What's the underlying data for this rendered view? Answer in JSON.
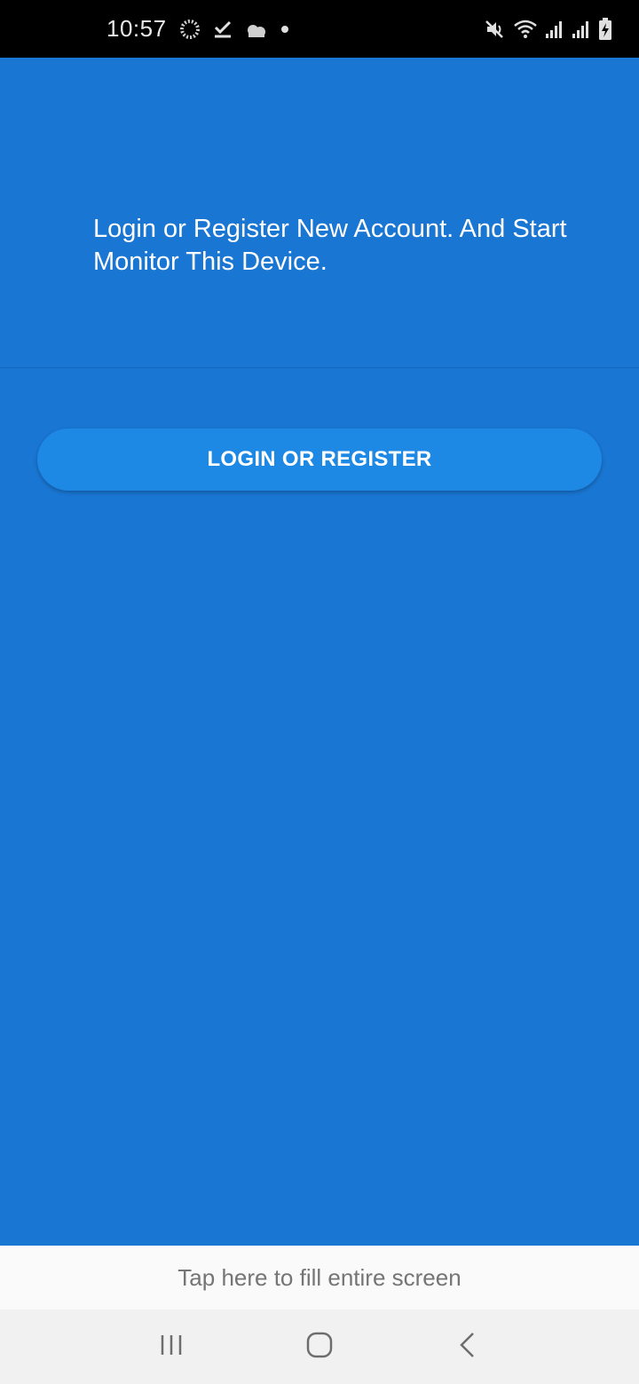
{
  "status_bar": {
    "time": "10:57",
    "left_icons": [
      "loading-circle-icon",
      "download-check-icon",
      "cloud-icon",
      "dot-icon"
    ],
    "right_icons": [
      "mute-icon",
      "wifi-icon",
      "signal-icon",
      "signal-icon",
      "battery-charging-icon"
    ]
  },
  "header": {
    "message": "Login or Register New Account. And Start Monitor This Device."
  },
  "main": {
    "login_button_label": "LOGIN OR REGISTER"
  },
  "fill_banner": {
    "text": "Tap here to fill entire screen"
  },
  "nav_bar": {
    "buttons": [
      "recents-icon",
      "home-icon",
      "back-icon"
    ]
  },
  "colors": {
    "primary": "#1976d2",
    "button": "#1e88e5",
    "banner_bg": "#fafafa",
    "nav_bg": "#f1f1f1"
  }
}
